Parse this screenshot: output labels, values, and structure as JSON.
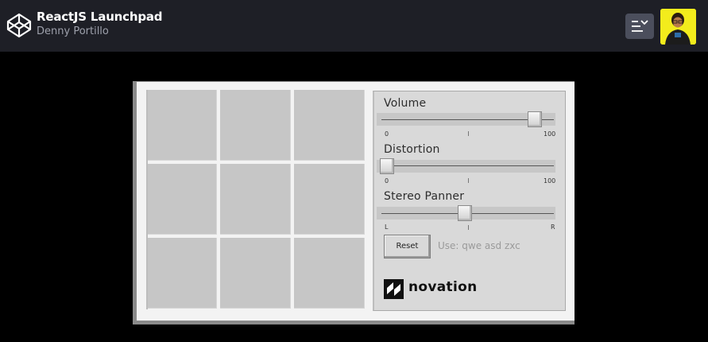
{
  "header": {
    "title": "ReactJS Launchpad",
    "author": "Denny Portillo",
    "logo_icon": "codepen-icon",
    "menu_icon": "menu-dropdown-icon",
    "avatar_icon": "user-avatar",
    "colors": {
      "background": "#1e1f26",
      "avatar_bg": "#f3ec1c"
    }
  },
  "launchpad": {
    "pads": [
      "",
      "",
      "",
      "",
      "",
      "",
      "",
      "",
      ""
    ],
    "volume": {
      "label": "Volume",
      "min_label": "0",
      "max_label": "100",
      "value": 95
    },
    "distortion": {
      "label": "Distortion",
      "min_label": "0",
      "max_label": "100",
      "value": 0
    },
    "panner": {
      "label": "Stereo Panner",
      "min_label": "L",
      "max_label": "R",
      "value": 0.5
    },
    "reset_label": "Reset",
    "hint": "Use: qwe asd zxc",
    "brand": "novation",
    "brand_icon": "novation-icon"
  }
}
